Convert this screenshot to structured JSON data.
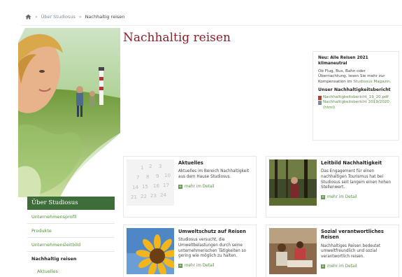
{
  "breadcrumb": {
    "home_icon": "home-icon",
    "items": [
      "Über Studiosus",
      "Nachhaltig reisen"
    ]
  },
  "page": {
    "title": "Nachhaltig reisen"
  },
  "sidebar": {
    "title": "Über Studiosus",
    "items": [
      {
        "label": "Unternehmensprofil"
      },
      {
        "label": "Produkte"
      },
      {
        "label": "Unternehmensleitbild"
      },
      {
        "label": "Nachhaltig reisen"
      },
      {
        "label": "Aktuelles"
      }
    ]
  },
  "infobox": {
    "heading": "Neu:  Alle Reisen 2021 klimaneutral",
    "text": "Ob Flug, Bus, Bahn oder Übernachtung, lesen Sie mehr zur Kompensation im ",
    "link": "Studiosus Magazin.",
    "heading2": "Unser Nachhaltigkeitsbericht",
    "downloads": [
      "Nachhaltigkeitsbericht_19_20.pdf",
      "Nachhaltigkeitsbericht 2019/2020 (html)"
    ]
  },
  "cards": [
    {
      "title": "Aktuelles",
      "desc": "Aktuelles im Bereich Nachhaltigkeit aus dem Hause Studiosus.",
      "more": "mehr im Detail"
    },
    {
      "title": "Leitbild Nachhaltigkeit",
      "desc": "Das Engagement für einen nachhaltigen Tourismus hat bei Studiosus seit langem einen hohen Stellenwert.",
      "more": "mehr im Detail"
    },
    {
      "title": "Umweltschutz auf Reisen",
      "desc": "Studiosus versucht, die Umweltbelastungen durch seine unternehmerischen Tätigkeiten so gering wie möglich zu halten.",
      "more": "mehr im Detail"
    },
    {
      "title": "Sozial verantwortliches Reisen",
      "desc": "Nachhaltiges Reisen bedeutet umweltfreundlich und sozial verantwortlich reisen.",
      "more": "mehr im Detail"
    }
  ],
  "colors": {
    "accent_green": "#3d6e3a",
    "title_red": "#8a1f2a",
    "link_green": "#5a8a45"
  }
}
